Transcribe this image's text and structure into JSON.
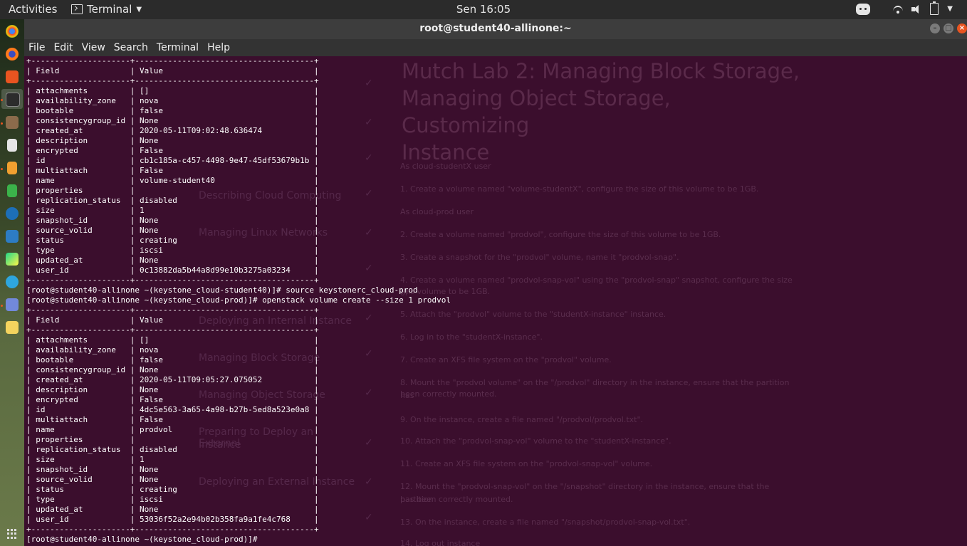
{
  "topbar": {
    "activities": "Activities",
    "app_name": "Terminal",
    "clock": "Sen 16:05"
  },
  "dock": {
    "apps": [
      "chrome-icon",
      "firefox-icon",
      "software-icon",
      "terminal-icon",
      "files-icon",
      "text-editor-icon",
      "document-icon",
      "spreadsheet-icon",
      "settings-icon",
      "virtualbox-icon",
      "pycharm-icon",
      "telegram-icon",
      "discord-icon",
      "notes-icon"
    ]
  },
  "window": {
    "title": "root@student40-allinone:~",
    "menu": [
      "File",
      "Edit",
      "View",
      "Search",
      "Terminal",
      "Help"
    ]
  },
  "background_doc": {
    "title_lines": [
      "Mutch Lab 2: Managing Block Storage,",
      "Managing Object Storage, Customizing",
      "Instance"
    ],
    "lines": [
      "As cloud-studentX user",
      "1. Create a volume named \"volume-studentX\", configure the size of this volume to be 1GB.",
      "As cloud-prod user",
      "2. Create a volume named \"prodvol\", configure the size of this volume to be 1GB.",
      "3. Create a snapshot for the \"prodvol\" volume, name it \"prodvol-snap\".",
      "4. Create a volume named \"prodvol-snap-vol\" using the \"prodvol-snap\" snapshot, configure the size of",
      "this volume to be 1GB.",
      "5. Attach the \"prodvol\" volume to the \"studentX-instance\" instance.",
      "6. Log in to the \"studentX-instance\".",
      "7. Create an XFS file system on the \"prodvol\" volume.",
      "8. Mount the \"prodvol volume\" on the \"/prodvol\" directory in the instance, ensure that the partition has",
      "been correctly mounted.",
      "9. On the instance, create a file named \"/prodvol/prodvol.txt\".",
      "10. Attach the \"prodvol-snap-vol\" volume to the \"studentX-instance\".",
      "11. Create an XFS file system on the \"prodvol-snap-vol\" volume.",
      "12. Mount the \"prodvol-snap-vol\" on the \"/snapshot\" directory in the instance, ensure that the partition",
      "has been correctly mounted.",
      "13. On the instance, create a file named \"/snapshot/prodvol-snap-vol.txt\".",
      "14. Log out instance"
    ],
    "nav": [
      "Describing Cloud Computing",
      "Managing Linux Networks",
      "Deploying an Internal Instance",
      "Managing Block Storage",
      "Managing Object Storage",
      "Preparing to Deploy an External",
      "Instance",
      "Deploying an External Instance"
    ]
  },
  "terminal": {
    "lines": [
      "+---------------------+--------------------------------------+",
      "| Field               | Value                                |",
      "+---------------------+--------------------------------------+",
      "| attachments         | []                                   |",
      "| availability_zone   | nova                                 |",
      "| bootable            | false                                |",
      "| consistencygroup_id | None                                 |",
      "| created_at          | 2020-05-11T09:02:48.636474           |",
      "| description         | None                                 |",
      "| encrypted           | False                                |",
      "| id                  | cb1c185a-c457-4498-9e47-45df53679b1b |",
      "| multiattach         | False                                |",
      "| name                | volume-student40                     |",
      "| properties          |                                      |",
      "| replication_status  | disabled                             |",
      "| size                | 1                                    |",
      "| snapshot_id         | None                                 |",
      "| source_volid        | None                                 |",
      "| status              | creating                             |",
      "| type                | iscsi                                |",
      "| updated_at          | None                                 |",
      "| user_id             | 0c13882da5b44a8d99e10b3275a03234     |",
      "+---------------------+--------------------------------------+",
      "[root@student40-allinone ~(keystone_cloud-student40)]# source keystonerc_cloud-prod",
      "[root@student40-allinone ~(keystone_cloud-prod)]# openstack volume create --size 1 prodvol",
      "+---------------------+--------------------------------------+",
      "| Field               | Value                                |",
      "+---------------------+--------------------------------------+",
      "| attachments         | []                                   |",
      "| availability_zone   | nova                                 |",
      "| bootable            | false                                |",
      "| consistencygroup_id | None                                 |",
      "| created_at          | 2020-05-11T09:05:27.075052           |",
      "| description         | None                                 |",
      "| encrypted           | False                                |",
      "| id                  | 4dc5e563-3a65-4a98-b27b-5ed8a523e0a8 |",
      "| multiattach         | False                                |",
      "| name                | prodvol                              |",
      "| properties          |                                      |",
      "| replication_status  | disabled                             |",
      "| size                | 1                                    |",
      "| snapshot_id         | None                                 |",
      "| source_volid        | None                                 |",
      "| status              | creating                             |",
      "| type                | iscsi                                |",
      "| updated_at          | None                                 |",
      "| user_id             | 53036f52a2e94b02b358fa9a1fe4c768     |",
      "+---------------------+--------------------------------------+",
      "[root@student40-allinone ~(keystone_cloud-prod)]#"
    ]
  },
  "colors": {
    "terminal_bg": "#3b0e2d",
    "topbar_bg": "#2b2b2b",
    "close_button": "#e95420"
  }
}
